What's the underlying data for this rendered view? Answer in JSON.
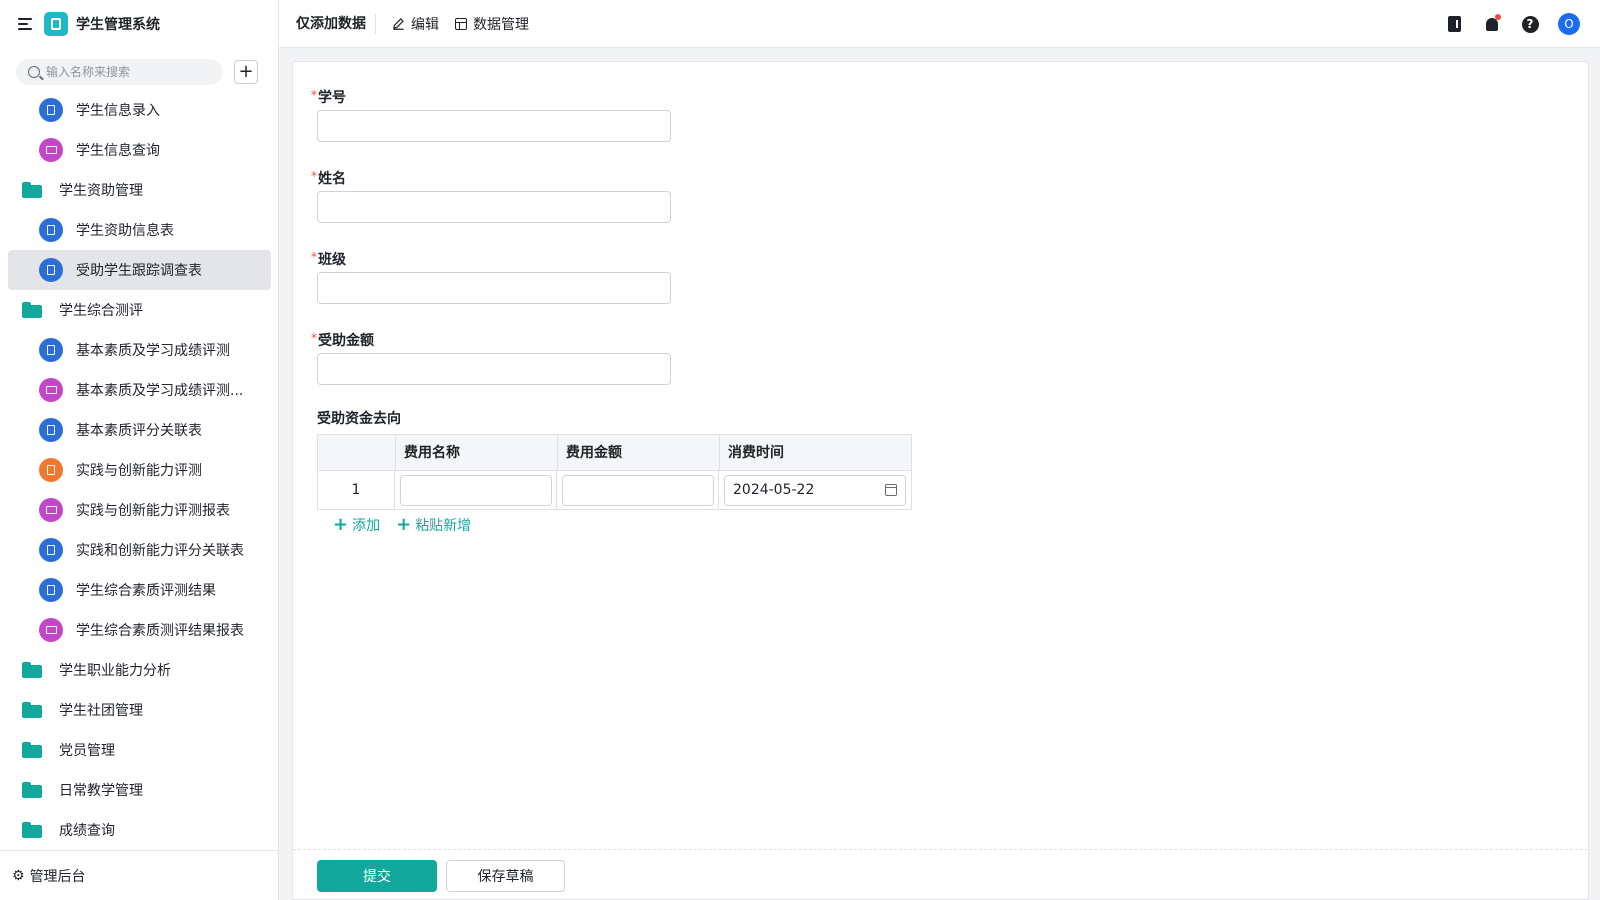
{
  "app": {
    "title": "学生管理系统"
  },
  "sidebar": {
    "search_placeholder": "输入名称来搜索",
    "add_label": "+",
    "items": [
      {
        "label": "学生信息录入",
        "type": "form",
        "color": "#2b6fd6"
      },
      {
        "label": "学生信息查询",
        "type": "report",
        "color": "#c247c8"
      },
      {
        "label": "学生资助管理",
        "type": "folder"
      },
      {
        "label": "学生资助信息表",
        "type": "form",
        "color": "#2b6fd6"
      },
      {
        "label": "受助学生跟踪调查表",
        "type": "form",
        "color": "#2b6fd6",
        "active": true
      },
      {
        "label": "学生综合测评",
        "type": "folder"
      },
      {
        "label": "基本素质及学习成绩评测",
        "type": "form",
        "color": "#2b6fd6"
      },
      {
        "label": "基本素质及学习成绩评测...",
        "type": "report",
        "color": "#c247c8"
      },
      {
        "label": "基本素质评分关联表",
        "type": "form",
        "color": "#2b6fd6"
      },
      {
        "label": "实践与创新能力评测",
        "type": "flow",
        "color": "#f0782e"
      },
      {
        "label": "实践与创新能力评测报表",
        "type": "report",
        "color": "#c247c8"
      },
      {
        "label": "实践和创新能力评分关联表",
        "type": "form",
        "color": "#2b6fd6"
      },
      {
        "label": "学生综合素质评测结果",
        "type": "form",
        "color": "#2b6fd6"
      },
      {
        "label": "学生综合素质测评结果报表",
        "type": "report",
        "color": "#c247c8"
      },
      {
        "label": "学生职业能力分析",
        "type": "folder"
      },
      {
        "label": "学生社团管理",
        "type": "folder"
      },
      {
        "label": "党员管理",
        "type": "folder"
      },
      {
        "label": "日常教学管理",
        "type": "folder"
      },
      {
        "label": "成绩查询",
        "type": "folder"
      }
    ],
    "footer_label": "管理后台"
  },
  "topbar": {
    "title": "仅添加数据",
    "edit_label": "编辑",
    "data_manage_label": "数据管理",
    "avatar_letter": "O",
    "help_glyph": "?"
  },
  "form": {
    "fields": [
      {
        "label": "学号",
        "required": "*",
        "value": ""
      },
      {
        "label": "姓名",
        "required": "*",
        "value": ""
      },
      {
        "label": "班级",
        "required": "*",
        "value": ""
      },
      {
        "label": "受助金额",
        "required": "*",
        "value": ""
      }
    ],
    "subtable": {
      "label": "受助资金去向",
      "headers": [
        "",
        "费用名称",
        "费用金额",
        "消费时间"
      ],
      "rows": [
        {
          "index": "1",
          "name": "",
          "amount": "",
          "date": "2024-05-22"
        }
      ],
      "add_label": "添加",
      "paste_label": "粘贴新增"
    },
    "submit_label": "提交",
    "draft_label": "保存草稿"
  },
  "colors": {
    "accent": "#13a89e",
    "required": "#f54a45",
    "avatar": "#1c6cf2"
  }
}
